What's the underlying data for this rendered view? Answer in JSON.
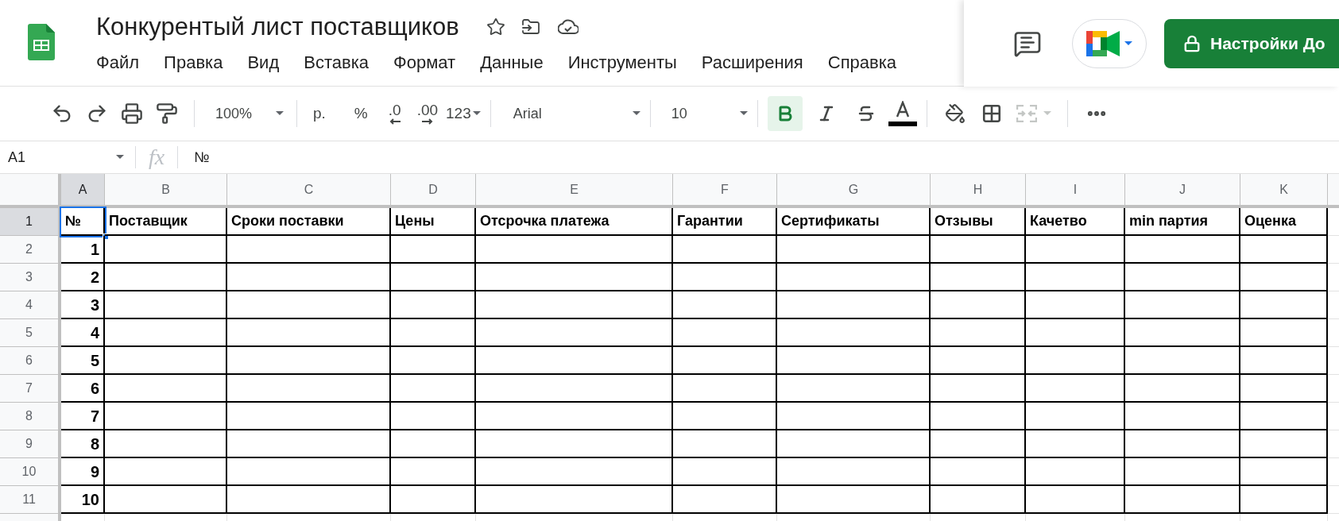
{
  "document": {
    "title": "Конкурентый лист поставщиков"
  },
  "menu": [
    "Файл",
    "Правка",
    "Вид",
    "Вставка",
    "Формат",
    "Данные",
    "Инструменты",
    "Расширения",
    "Справка"
  ],
  "actions": {
    "share_button": "Настройки До"
  },
  "toolbar": {
    "zoom": "100%",
    "currency": "р.",
    "percent": "%",
    "decrease_decimals": ".0",
    "increase_decimals": ".00",
    "number_format": "123",
    "font": "Arial",
    "font_size": "10",
    "bold": true,
    "italic": false,
    "strikethrough": false,
    "merge_disabled": true
  },
  "formula_bar": {
    "cell_ref": "A1",
    "fx": "fx",
    "value": "№"
  },
  "sheet": {
    "columns": [
      {
        "label": "A",
        "selected": true
      },
      {
        "label": "B",
        "selected": false
      },
      {
        "label": "C",
        "selected": false
      },
      {
        "label": "D",
        "selected": false
      },
      {
        "label": "E",
        "selected": false
      },
      {
        "label": "F",
        "selected": false
      },
      {
        "label": "G",
        "selected": false
      },
      {
        "label": "H",
        "selected": false
      },
      {
        "label": "I",
        "selected": false
      },
      {
        "label": "J",
        "selected": false
      },
      {
        "label": "K",
        "selected": false
      }
    ],
    "rows": [
      {
        "label": "1",
        "selected": true,
        "cells": [
          "№",
          "Поставщик",
          "Сроки поставки",
          "Цены",
          "Отсрочка платежа",
          "Гарантии",
          "Сертификаты",
          "Отзывы",
          "Качетво",
          "min партия",
          "Оценка"
        ]
      },
      {
        "label": "2",
        "selected": false,
        "cells": [
          "1"
        ]
      },
      {
        "label": "3",
        "selected": false,
        "cells": [
          "2"
        ]
      },
      {
        "label": "4",
        "selected": false,
        "cells": [
          "3"
        ]
      },
      {
        "label": "5",
        "selected": false,
        "cells": [
          "4"
        ]
      },
      {
        "label": "6",
        "selected": false,
        "cells": [
          "5"
        ]
      },
      {
        "label": "7",
        "selected": false,
        "cells": [
          "6"
        ]
      },
      {
        "label": "8",
        "selected": false,
        "cells": [
          "7"
        ]
      },
      {
        "label": "9",
        "selected": false,
        "cells": [
          "8"
        ]
      },
      {
        "label": "10",
        "selected": false,
        "cells": [
          "9"
        ]
      },
      {
        "label": "11",
        "selected": false,
        "cells": [
          "10"
        ]
      }
    ]
  }
}
